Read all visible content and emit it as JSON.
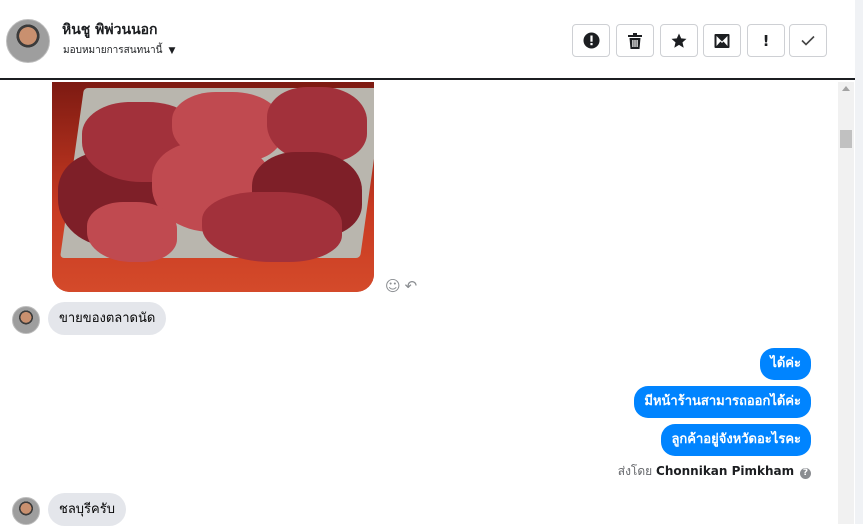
{
  "header": {
    "contact_name": "หินชู พิพ่วนนอก",
    "assign_label": "มอบหมายการสนทนานี้",
    "toolbar": [
      {
        "name": "spam-button",
        "icon": "alert-circle-icon",
        "glyph": "⬤"
      },
      {
        "name": "delete-button",
        "icon": "trash-icon",
        "glyph": "🗑"
      },
      {
        "name": "star-button",
        "icon": "star-icon",
        "glyph": "★"
      },
      {
        "name": "mark-unread-button",
        "icon": "envelope-icon",
        "glyph": "✉"
      },
      {
        "name": "follow-up-button",
        "icon": "exclamation-icon",
        "glyph": "!"
      },
      {
        "name": "mark-done-button",
        "icon": "checkmark-icon",
        "glyph": "✓"
      }
    ]
  },
  "messages": {
    "incoming_1": "ขายของตลาดนัด",
    "outgoing": [
      "ได้ค่ะ",
      "มีหน้าร้านสามารถออกได้ค่ะ",
      "ลูกค้าอยู่จังหวัดอะไรคะ"
    ],
    "sent_by_prefix": "ส่งโดย",
    "sent_by_agent": "Chonnikan Pimkham",
    "incoming_2": "ชลบุรีครับ"
  },
  "colors": {
    "outgoing_bubble": "#0084ff",
    "incoming_bubble": "#e4e6eb"
  }
}
